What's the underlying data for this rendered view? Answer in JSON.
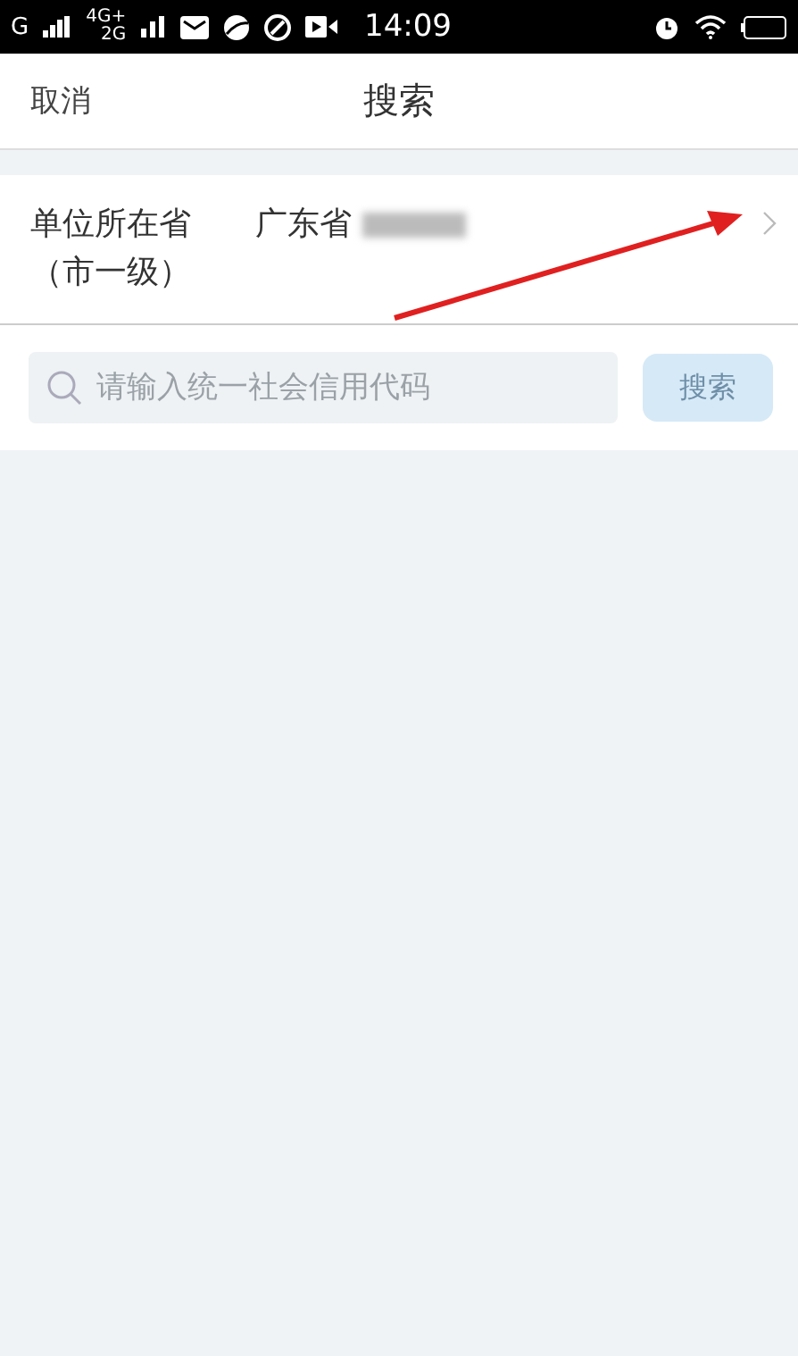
{
  "status_bar": {
    "carrier_1": "G",
    "carrier_2_top": "4G+",
    "carrier_2_bottom": "2G",
    "time": "14:09"
  },
  "nav": {
    "cancel": "取消",
    "title": "搜索"
  },
  "region_row": {
    "label_line_1": "单位所在省",
    "label_line_2": "（市一级）",
    "value": "广东省",
    "value_redacted": true
  },
  "search": {
    "placeholder": "请输入统一社会信用代码",
    "button": "搜索",
    "button_disabled": true
  },
  "annotation": {
    "kind": "arrow",
    "color": "#e02020"
  }
}
